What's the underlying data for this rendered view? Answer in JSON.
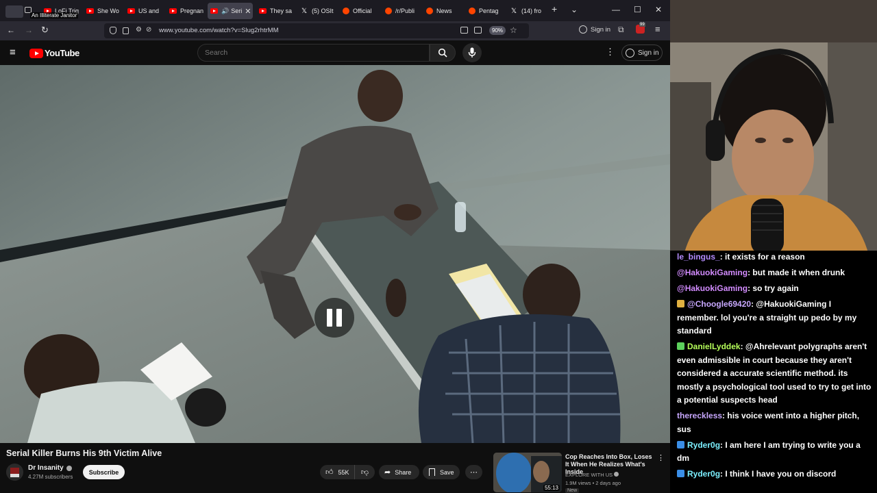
{
  "browser": {
    "profile_tooltip": "An Illiterate Janitor",
    "tabs": [
      {
        "label": "LoFi Trig",
        "icon": "youtube-icon"
      },
      {
        "label": "She Wo",
        "icon": "youtube-icon"
      },
      {
        "label": "US and",
        "icon": "youtube-icon"
      },
      {
        "label": "Pregnan",
        "icon": "youtube-icon"
      },
      {
        "label": "Seri",
        "icon": "youtube-icon",
        "active": true
      },
      {
        "label": "They sa",
        "icon": "youtube-icon"
      },
      {
        "label": "(5) OSIt",
        "icon": "x-icon"
      },
      {
        "label": "Official",
        "icon": "reddit-icon"
      },
      {
        "label": "/r/Publi",
        "icon": "reddit-icon"
      },
      {
        "label": "News",
        "icon": "reddit-icon"
      },
      {
        "label": "Pentag",
        "icon": "reddit-icon"
      },
      {
        "label": "(14) fro",
        "icon": "x-icon"
      }
    ],
    "url": "www.youtube.com/watch?v=Slug2rhtrMM",
    "zoom": "90%",
    "sign_in": "Sign in",
    "extension_badge": "99"
  },
  "youtube": {
    "logo_text": "YouTube",
    "search_placeholder": "Search",
    "sign_in": "Sign in",
    "video": {
      "title": "Serial Killer Burns His 9th Victim Alive",
      "channel": "Dr Insanity",
      "subscribers": "4.27M subscribers",
      "subscribe": "Subscribe",
      "likes": "55K",
      "share": "Share",
      "save": "Save"
    },
    "recommended": {
      "title": "Cop Reaches Into Box, Loses It When He Realizes What's Inside",
      "channel": "EXPLORE WITH US",
      "meta": "1.9M views • 2 days ago",
      "badge": "New",
      "duration": "55:13"
    }
  },
  "chat": {
    "messages": [
      {
        "user": "le_bingus_",
        "text": ": it exists for a reason",
        "color": "#b48cff",
        "badge": ""
      },
      {
        "user": "@HakuokiGaming",
        "text": ": but made it when drunk",
        "color": "#d38cff",
        "badge": ""
      },
      {
        "user": "@HakuokiGaming",
        "text": ": so try again",
        "color": "#d38cff",
        "badge": ""
      },
      {
        "user": "@Choogle69420",
        "text": ": @HakuokiGaming I remember. lol you're a straight up pedo by my standard",
        "color": "#c8a8ff",
        "badge": "#e0b040"
      },
      {
        "user": "DanielLyddek",
        "text": ": @Ahrelevant polygraphs aren't even admissible in court because they aren't considered a accurate scientific method. its mostly a psychological tool used to try to get into a potential suspects head",
        "color": "#b6ff5a",
        "badge": "#5cd05c"
      },
      {
        "user": "thereckless",
        "text": ": his voice went into a higher pitch, sus",
        "color": "#c8a8ff",
        "badge": ""
      },
      {
        "user": "Ryder0g",
        "text": ": I am here I am trying to write you a dm",
        "color": "#7cf0ff",
        "badge": "#3a8ee6"
      },
      {
        "user": "Ryder0g",
        "text": ": I think I have you on discord",
        "color": "#7cf0ff",
        "badge": "#3a8ee6"
      }
    ]
  }
}
